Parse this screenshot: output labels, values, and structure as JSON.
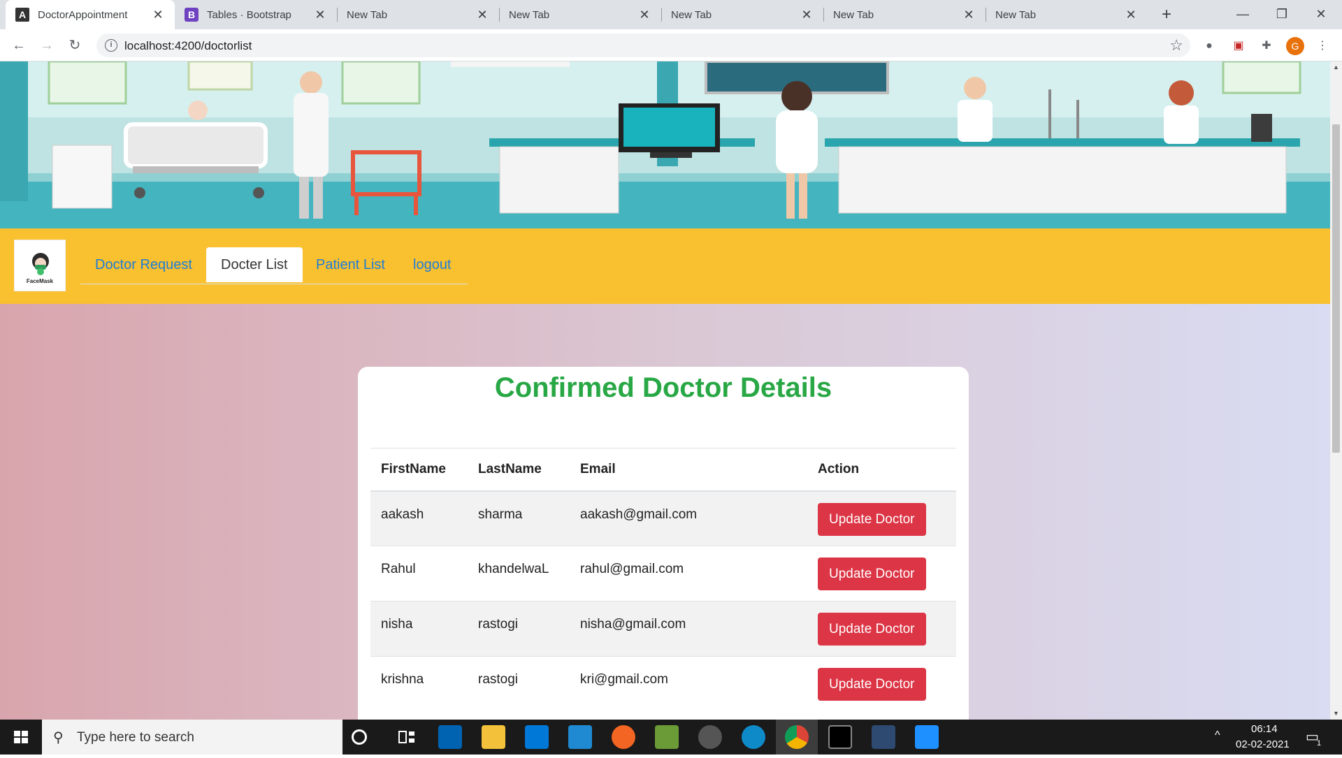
{
  "browser": {
    "tabs": [
      {
        "title": "DoctorAppointment",
        "favicon": "angular-icon",
        "active": true
      },
      {
        "title": "Tables · Bootstrap",
        "favicon": "bootstrap-icon",
        "active": false
      },
      {
        "title": "New Tab",
        "favicon": "",
        "active": false
      },
      {
        "title": "New Tab",
        "favicon": "",
        "active": false
      },
      {
        "title": "New Tab",
        "favicon": "",
        "active": false
      },
      {
        "title": "New Tab",
        "favicon": "",
        "active": false
      },
      {
        "title": "New Tab",
        "favicon": "",
        "active": false
      }
    ],
    "url": "localhost:4200/doctorlist",
    "profile_initial": "G"
  },
  "app": {
    "logo_caption": "FaceMask",
    "nav": [
      {
        "label": "Doctor Request",
        "active": false
      },
      {
        "label": "Docter List",
        "active": true
      },
      {
        "label": "Patient List",
        "active": false
      },
      {
        "label": "logout",
        "active": false
      }
    ],
    "card_title": "Confirmed Doctor Details",
    "table": {
      "headers": [
        "FirstName",
        "LastName",
        "Email",
        "Action"
      ],
      "rows": [
        {
          "first": "aakash",
          "last": "sharma",
          "email": "aakash@gmail.com",
          "action": "Update Doctor"
        },
        {
          "first": "Rahul",
          "last": "khandelwaL",
          "email": "rahul@gmail.com",
          "action": "Update Doctor"
        },
        {
          "first": "nisha",
          "last": "rastogi",
          "email": "nisha@gmail.com",
          "action": "Update Doctor"
        },
        {
          "first": "krishna",
          "last": "rastogi",
          "email": "kri@gmail.com",
          "action": "Update Doctor"
        }
      ]
    }
  },
  "taskbar": {
    "search_placeholder": "Type here to search",
    "time": "06:14",
    "date": "02-02-2021",
    "notification_count": "1"
  },
  "colors": {
    "nav_yellow": "#f9c02f",
    "title_green": "#28a745",
    "button_red": "#dc3545",
    "link_blue": "#1e7dd8"
  }
}
